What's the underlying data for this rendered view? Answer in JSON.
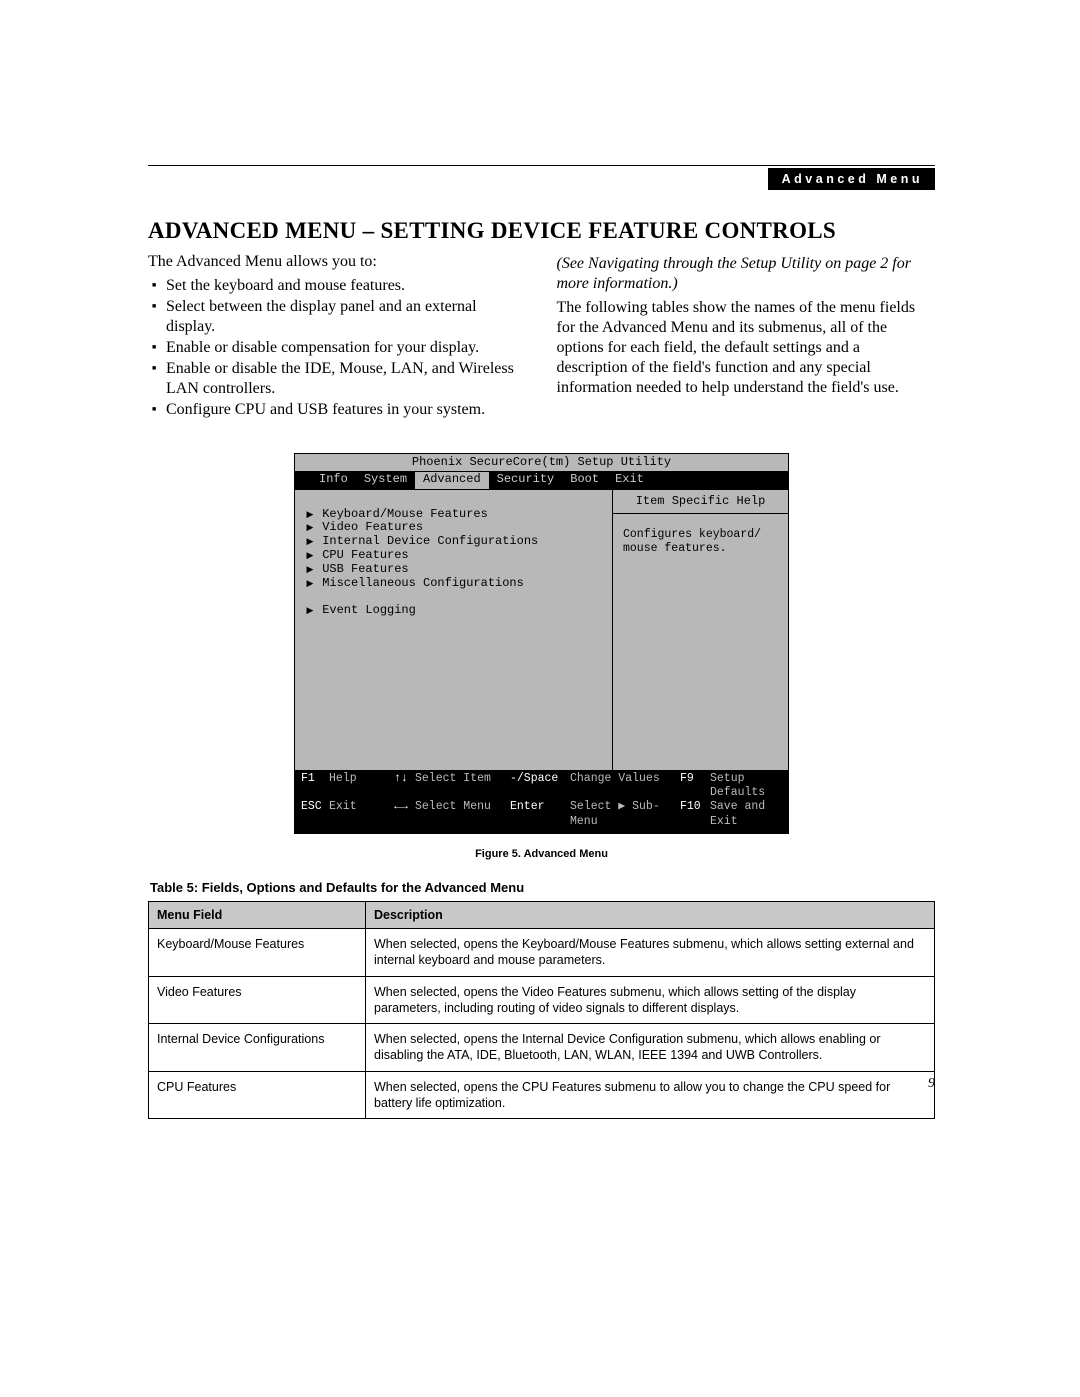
{
  "header": {
    "tab_label": "Advanced Menu"
  },
  "title": "ADVANCED MENU – SETTING DEVICE FEATURE CONTROLS",
  "left_col": {
    "intro": "The Advanced Menu allows you to:",
    "bullets": [
      "Set the keyboard and mouse features.",
      "Select between the display panel and an external display.",
      "Enable or disable compensation for your display.",
      "Enable or disable the IDE, Mouse, LAN, and Wireless LAN controllers.",
      "Configure CPU and USB features in your system."
    ]
  },
  "right_col": {
    "note": "(See Navigating through the Setup Utility on page 2 for more information.)",
    "para": "The following tables show the names of the menu fields for the Advanced Menu and its submenus, all of the options for each field, the default settings and a description of the field's function and any special information needed to help understand the field's use."
  },
  "bios": {
    "title": "Phoenix SecureCore(tm) Setup Utility",
    "tabs": [
      "Info",
      "System",
      "Advanced",
      "Security",
      "Boot",
      "Exit"
    ],
    "active_tab": "Advanced",
    "menu_items": [
      "Keyboard/Mouse Features",
      "Video Features",
      "Internal Device Configurations",
      "CPU Features",
      "USB Features",
      "Miscellaneous Configurations"
    ],
    "menu_items2": [
      "Event Logging"
    ],
    "help_title": "Item Specific Help",
    "help_body": "Configures keyboard/\nmouse features.",
    "footer": {
      "r1": {
        "k1": "F1",
        "v1": "Help",
        "k2": "↑↓",
        "v2": "Select Item",
        "k3": "-/Space",
        "v3": "Change Values",
        "k4": "F9",
        "v4": "Setup Defaults"
      },
      "r2": {
        "k1": "ESC",
        "v1": "Exit",
        "k2": "←→",
        "v2": "Select Menu",
        "k3": "Enter",
        "v3": "Select ▶ Sub-Menu",
        "k4": "F10",
        "v4": "Save and Exit"
      }
    }
  },
  "figure_caption": "Figure 5.  Advanced Menu",
  "table_caption": "Table 5: Fields, Options and Defaults for the Advanced Menu",
  "table": {
    "head": {
      "field": "Menu Field",
      "desc": "Description"
    },
    "rows": [
      {
        "field": "Keyboard/Mouse Features",
        "desc": "When selected, opens the Keyboard/Mouse Features submenu, which allows setting external and internal keyboard and mouse parameters."
      },
      {
        "field": "Video Features",
        "desc": "When selected, opens the Video Features submenu, which allows setting of the display parameters, including routing of video signals to different displays."
      },
      {
        "field": "Internal Device Configurations",
        "desc": "When selected, opens the Internal Device Configuration submenu, which allows enabling or disabling the ATA, IDE, Bluetooth, LAN, WLAN, IEEE 1394 and UWB Controllers."
      },
      {
        "field": "CPU Features",
        "desc": "When selected, opens the CPU Features submenu to allow you to change the CPU speed for battery life optimization."
      }
    ]
  },
  "page_number": "9"
}
